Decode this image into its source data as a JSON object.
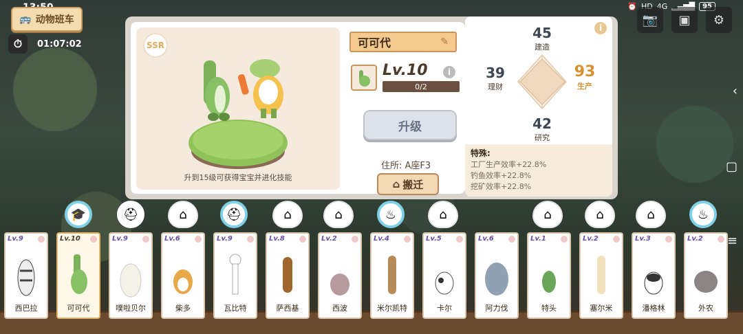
{
  "status_bar": {
    "time": "13:50",
    "network": "4G",
    "battery": "95"
  },
  "top_left": {
    "bus_label": "动物班车",
    "timer": "01:07:02"
  },
  "detail": {
    "rarity": "SSR",
    "name": "可可代",
    "level": "Lv.10",
    "xp": "0/2",
    "evolution_hint": "升到15级可获得宝宝并进化技能",
    "upgrade_label": "升级",
    "residence_label": "住所:",
    "residence_value": "A座F3",
    "move_label": "搬迁"
  },
  "stats": {
    "build_value": "45",
    "build_label": "建造",
    "finance_value": "39",
    "finance_label": "理财",
    "production_value": "93",
    "production_label": "生产",
    "research_value": "42",
    "research_label": "研究"
  },
  "special": {
    "title": "特殊:",
    "lines": [
      "工厂生产效率+22.8%",
      "钓鱼效率+22.8%",
      "挖矿效率+22.8%"
    ]
  },
  "characters": [
    {
      "level": "Lv.9",
      "name": "西巴拉"
    },
    {
      "level": "Lv.10",
      "name": "可可代"
    },
    {
      "level": "Lv.9",
      "name": "噗啦贝尔"
    },
    {
      "level": "Lv.6",
      "name": "柴多"
    },
    {
      "level": "Lv.9",
      "name": "瓦比特"
    },
    {
      "level": "Lv.8",
      "name": "萨西基"
    },
    {
      "level": "Lv.2",
      "name": "西波"
    },
    {
      "level": "Lv.4",
      "name": "米尔凯特"
    },
    {
      "level": "Lv.5",
      "name": "卡尔"
    },
    {
      "level": "Lv.6",
      "name": "阿力伐"
    },
    {
      "level": "Lv.1",
      "name": "特头"
    },
    {
      "level": "Lv.2",
      "name": "塞尔米"
    },
    {
      "level": "Lv.3",
      "name": "潘格林"
    },
    {
      "level": "Lv.2",
      "name": "外农"
    }
  ],
  "colors": {
    "accent": "#f5c98e",
    "production_highlight": "#d69232",
    "panel_bg": "#d9d4cc"
  }
}
